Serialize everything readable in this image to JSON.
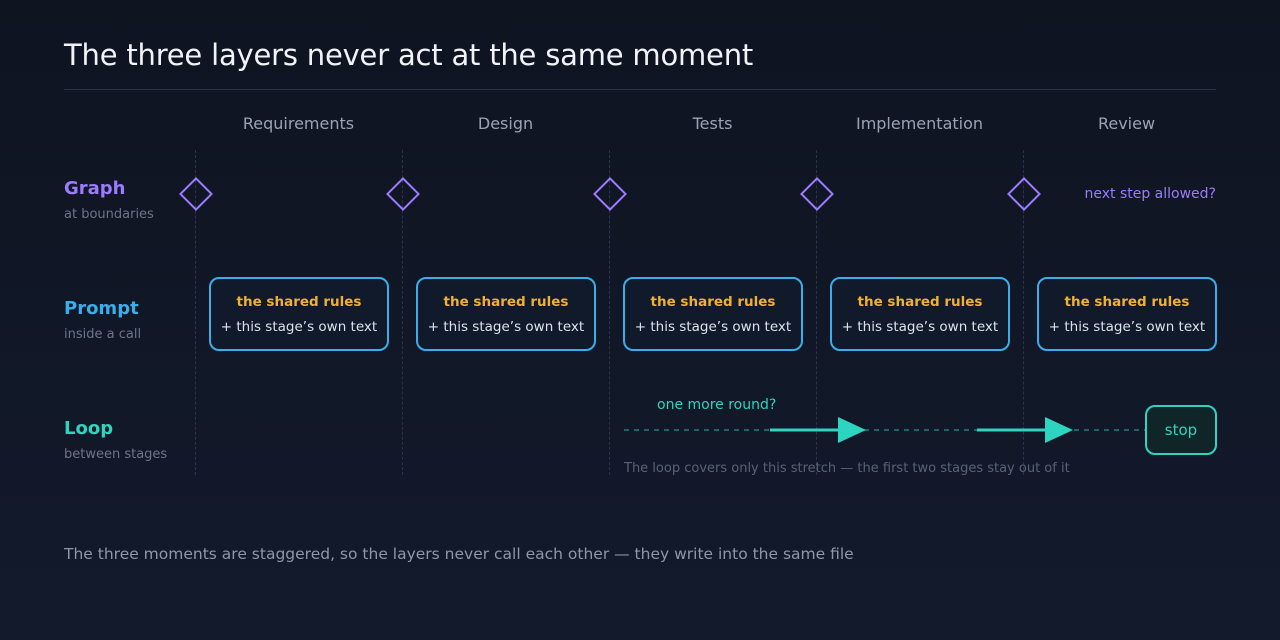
{
  "title": "The three layers never act at the same moment",
  "stages": [
    "Requirements",
    "Design",
    "Tests",
    "Implementation",
    "Review"
  ],
  "layers": {
    "graph": {
      "name": "Graph",
      "sub": "at boundaries",
      "note": "next step allowed?",
      "color": "#9b7bff"
    },
    "prompt": {
      "name": "Prompt",
      "sub": "inside a call",
      "line1": "the shared rules",
      "line2": "+ this stage’s own text",
      "color": "#3aaee8",
      "accent": "#f0b132"
    },
    "loop": {
      "name": "Loop",
      "sub": "between stages",
      "question": "one more round?",
      "stop": "stop",
      "note": "The loop covers only this stretch — the first two stages stay out of it",
      "color": "#2dd4bf"
    }
  },
  "footer": "The three moments are staggered, so the layers never call each other — they write into the same file"
}
